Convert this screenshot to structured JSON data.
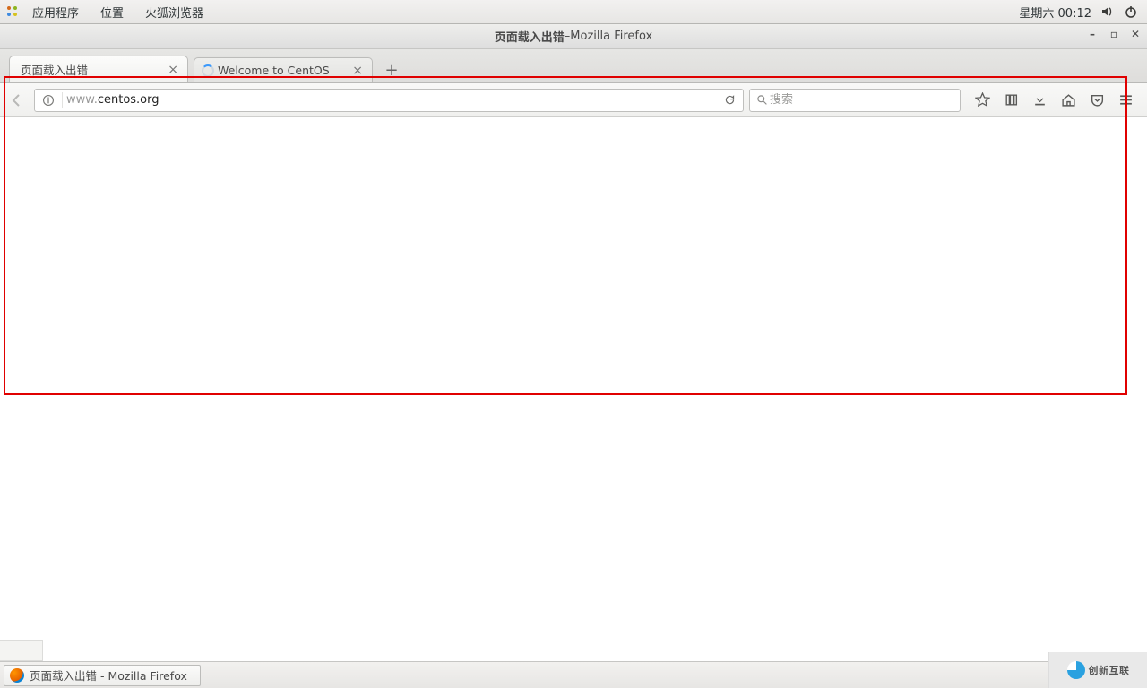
{
  "panel": {
    "menus": {
      "applications": "应用程序",
      "places": "位置",
      "firefox": "火狐浏览器"
    },
    "clock": "星期六 00:12"
  },
  "window": {
    "title_main": "页面载入出错",
    "title_sep": "  –  ",
    "title_app": "Mozilla Firefox"
  },
  "tabs": {
    "active": {
      "label": "页面载入出错"
    },
    "second": {
      "label": "Welcome to CentOS"
    }
  },
  "url": {
    "dim_prefix": "www.",
    "host": "centos.org",
    "full": "www.centos.org"
  },
  "search": {
    "placeholder": "搜索"
  },
  "task": {
    "label": "页面载入出错 - Mozilla Firefox"
  },
  "watermark": {
    "text": "创新互联"
  }
}
